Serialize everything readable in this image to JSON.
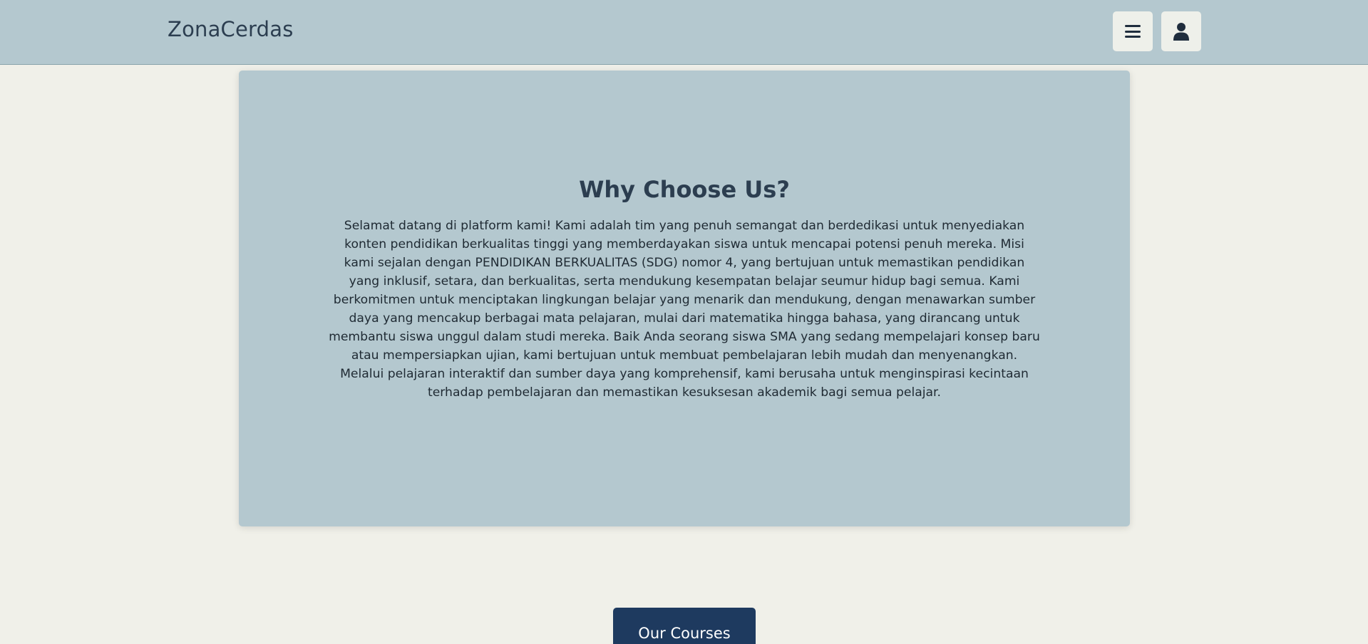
{
  "navbar": {
    "brand": "ZonaCerdas",
    "menu_icon": "hamburger-menu-icon",
    "user_icon": "user-icon"
  },
  "hero": {
    "title": "Why Choose Us?",
    "body": "Selamat datang di platform kami! Kami adalah tim yang penuh semangat dan berdedikasi untuk menyediakan konten pendidikan berkualitas tinggi yang memberdayakan siswa untuk mencapai potensi penuh mereka. Misi kami sejalan dengan PENDIDIKAN BERKUALITAS (SDG) nomor 4, yang bertujuan untuk memastikan pendidikan yang inklusif, setara, dan berkualitas, serta mendukung kesempatan belajar seumur hidup bagi semua. Kami berkomitmen untuk menciptakan lingkungan belajar yang menarik dan mendukung, dengan menawarkan sumber daya yang mencakup berbagai mata pelajaran, mulai dari matematika hingga bahasa, yang dirancang untuk membantu siswa unggul dalam studi mereka. Baik Anda seorang siswa SMA yang sedang mempelajari konsep baru atau mempersiapkan ujian, kami bertujuan untuk membuat pembelajaran lebih mudah dan menyenangkan. Melalui pelajaran interaktif dan sumber daya yang komprehensif, kami berusaha untuk menginspirasi kecintaan terhadap pembelajaran dan memastikan kesuksesan akademik bagi semua pelajar."
  },
  "cta": {
    "label": "Our Courses"
  },
  "colors": {
    "page_bg": "#f0f0e9",
    "navbar_bg": "#b4c8cf",
    "card_bg": "#b4c8cf",
    "button_bg": "#1e3a5f",
    "text_dark": "#2c3e50"
  }
}
